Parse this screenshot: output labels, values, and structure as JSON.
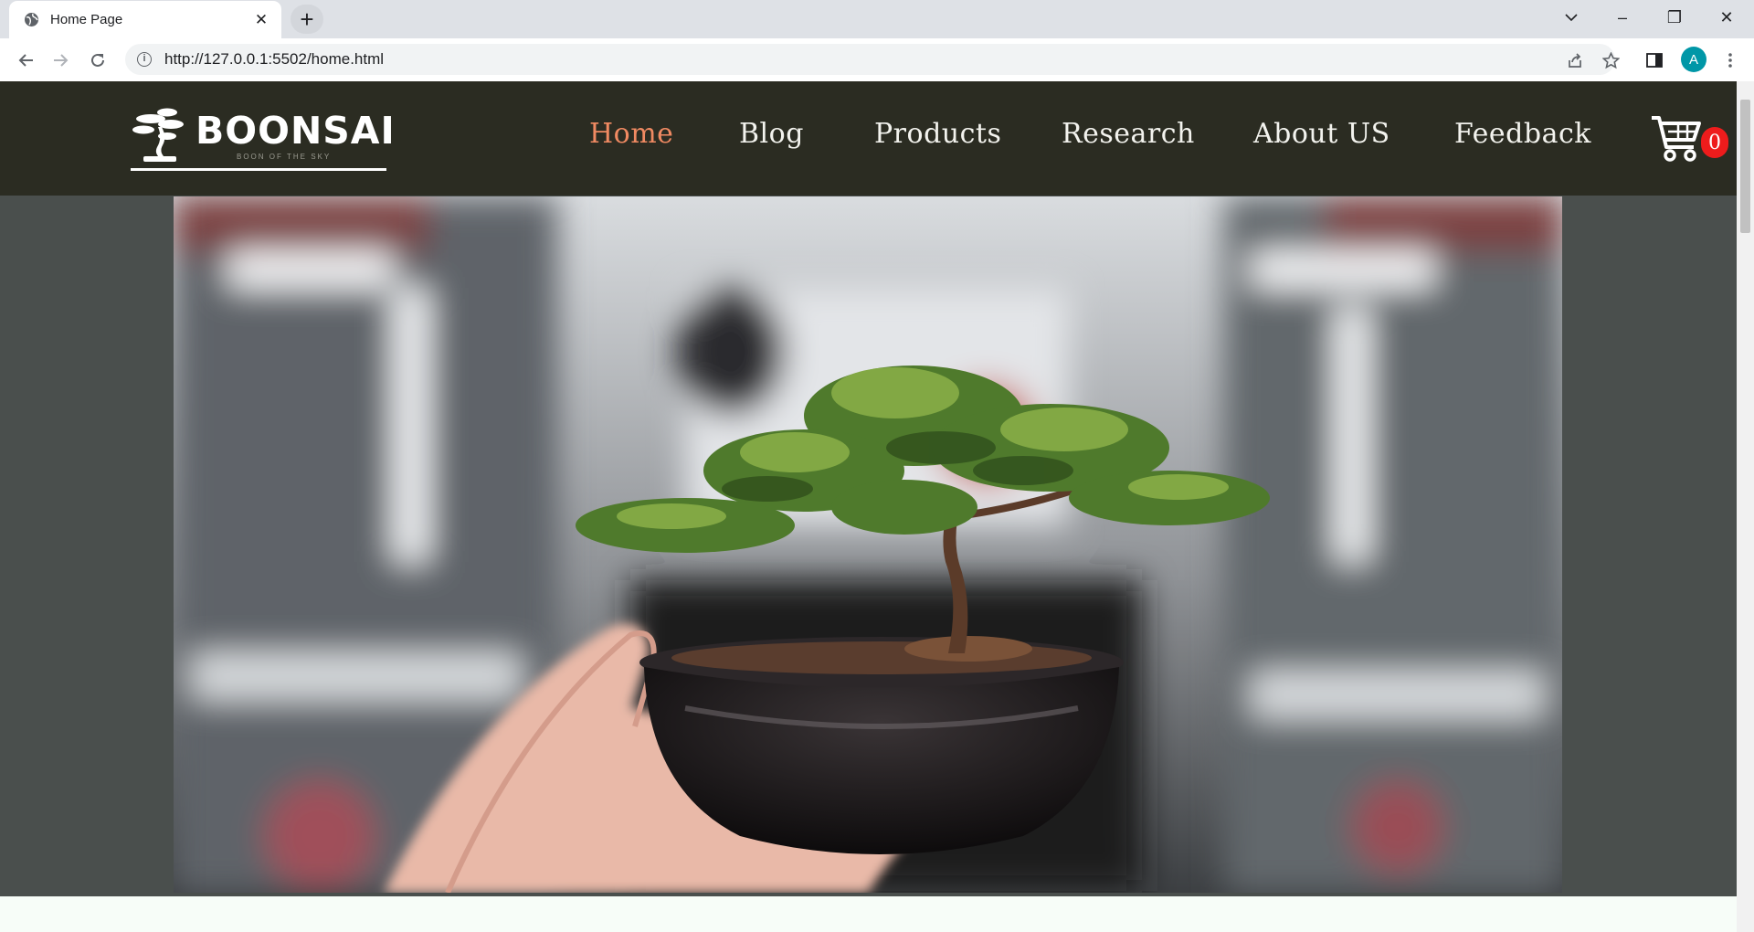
{
  "browser": {
    "tab_title": "Home Page",
    "tab_close": "✕",
    "new_tab": "+",
    "url": "http://127.0.0.1:5502/home.html",
    "profile_initial": "A",
    "window_controls": {
      "minimize": "–",
      "maximize": "❐",
      "close": "✕"
    }
  },
  "site": {
    "logo_text": "BOONSAI",
    "logo_tagline": "BOON OF THE SKY",
    "nav": [
      {
        "label": "Home",
        "active": true
      },
      {
        "label": "Blog",
        "active": false
      },
      {
        "label": "Products",
        "active": false
      },
      {
        "label": "Research",
        "active": false
      },
      {
        "label": "About US",
        "active": false
      },
      {
        "label": "Feedback",
        "active": false
      }
    ],
    "cart_count": "0"
  },
  "colors": {
    "nav_bg": "#2b2c22",
    "nav_active": "#f08a62",
    "cart_badge": "#ee1c1c",
    "page_bg": "#4a4f4d"
  },
  "icons": {
    "tab": "globe-icon",
    "back": "back-arrow-icon",
    "forward": "forward-arrow-icon",
    "reload": "reload-icon",
    "site_info": "info-icon",
    "share": "share-icon",
    "bookmark": "star-icon",
    "side_panel": "side-panel-icon",
    "menu": "kebab-menu-icon",
    "cart": "shopping-cart-icon"
  }
}
